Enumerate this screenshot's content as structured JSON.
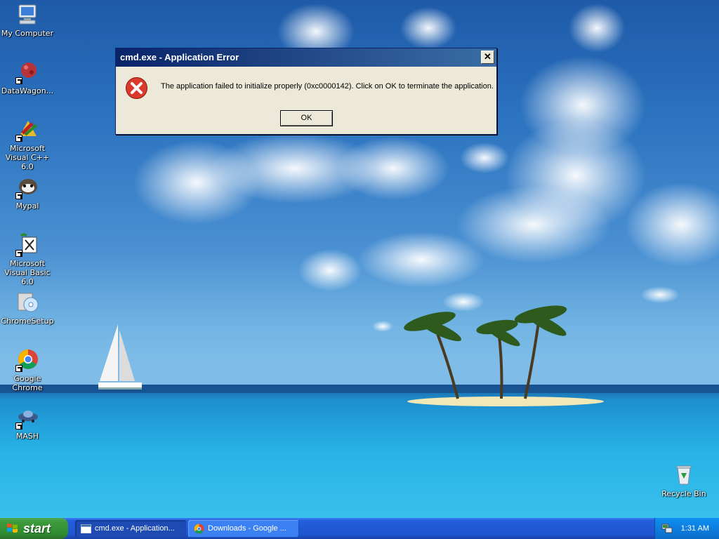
{
  "desktop": {
    "icons": [
      {
        "label": "My Computer"
      },
      {
        "label": "DataWagon..."
      },
      {
        "label": "Microsoft Visual C++ 6.0"
      },
      {
        "label": "Mypal"
      },
      {
        "label": "Microsoft Visual Basic 6.0"
      },
      {
        "label": "ChromeSetup"
      },
      {
        "label": "Google Chrome"
      },
      {
        "label": "MASH"
      },
      {
        "label": "Recycle Bin"
      }
    ]
  },
  "dialog": {
    "title": "cmd.exe - Application Error",
    "close_label": "✕",
    "message": "The application failed to initialize properly (0xc0000142). Click on OK to terminate the application.",
    "ok_label": "OK",
    "icon": "error-icon"
  },
  "taskbar": {
    "start_label": "start",
    "tasks": [
      {
        "label": "cmd.exe - Application...",
        "icon": "window-icon"
      },
      {
        "label": "Downloads - Google ...",
        "icon": "chrome-icon"
      }
    ],
    "clock": "1:31 AM"
  },
  "colors": {
    "titlebar": "#0a246a",
    "taskbar": "#245edb",
    "start": "#3c9a3c",
    "tray": "#0c7ee0",
    "dialog_bg": "#ece9d8"
  }
}
